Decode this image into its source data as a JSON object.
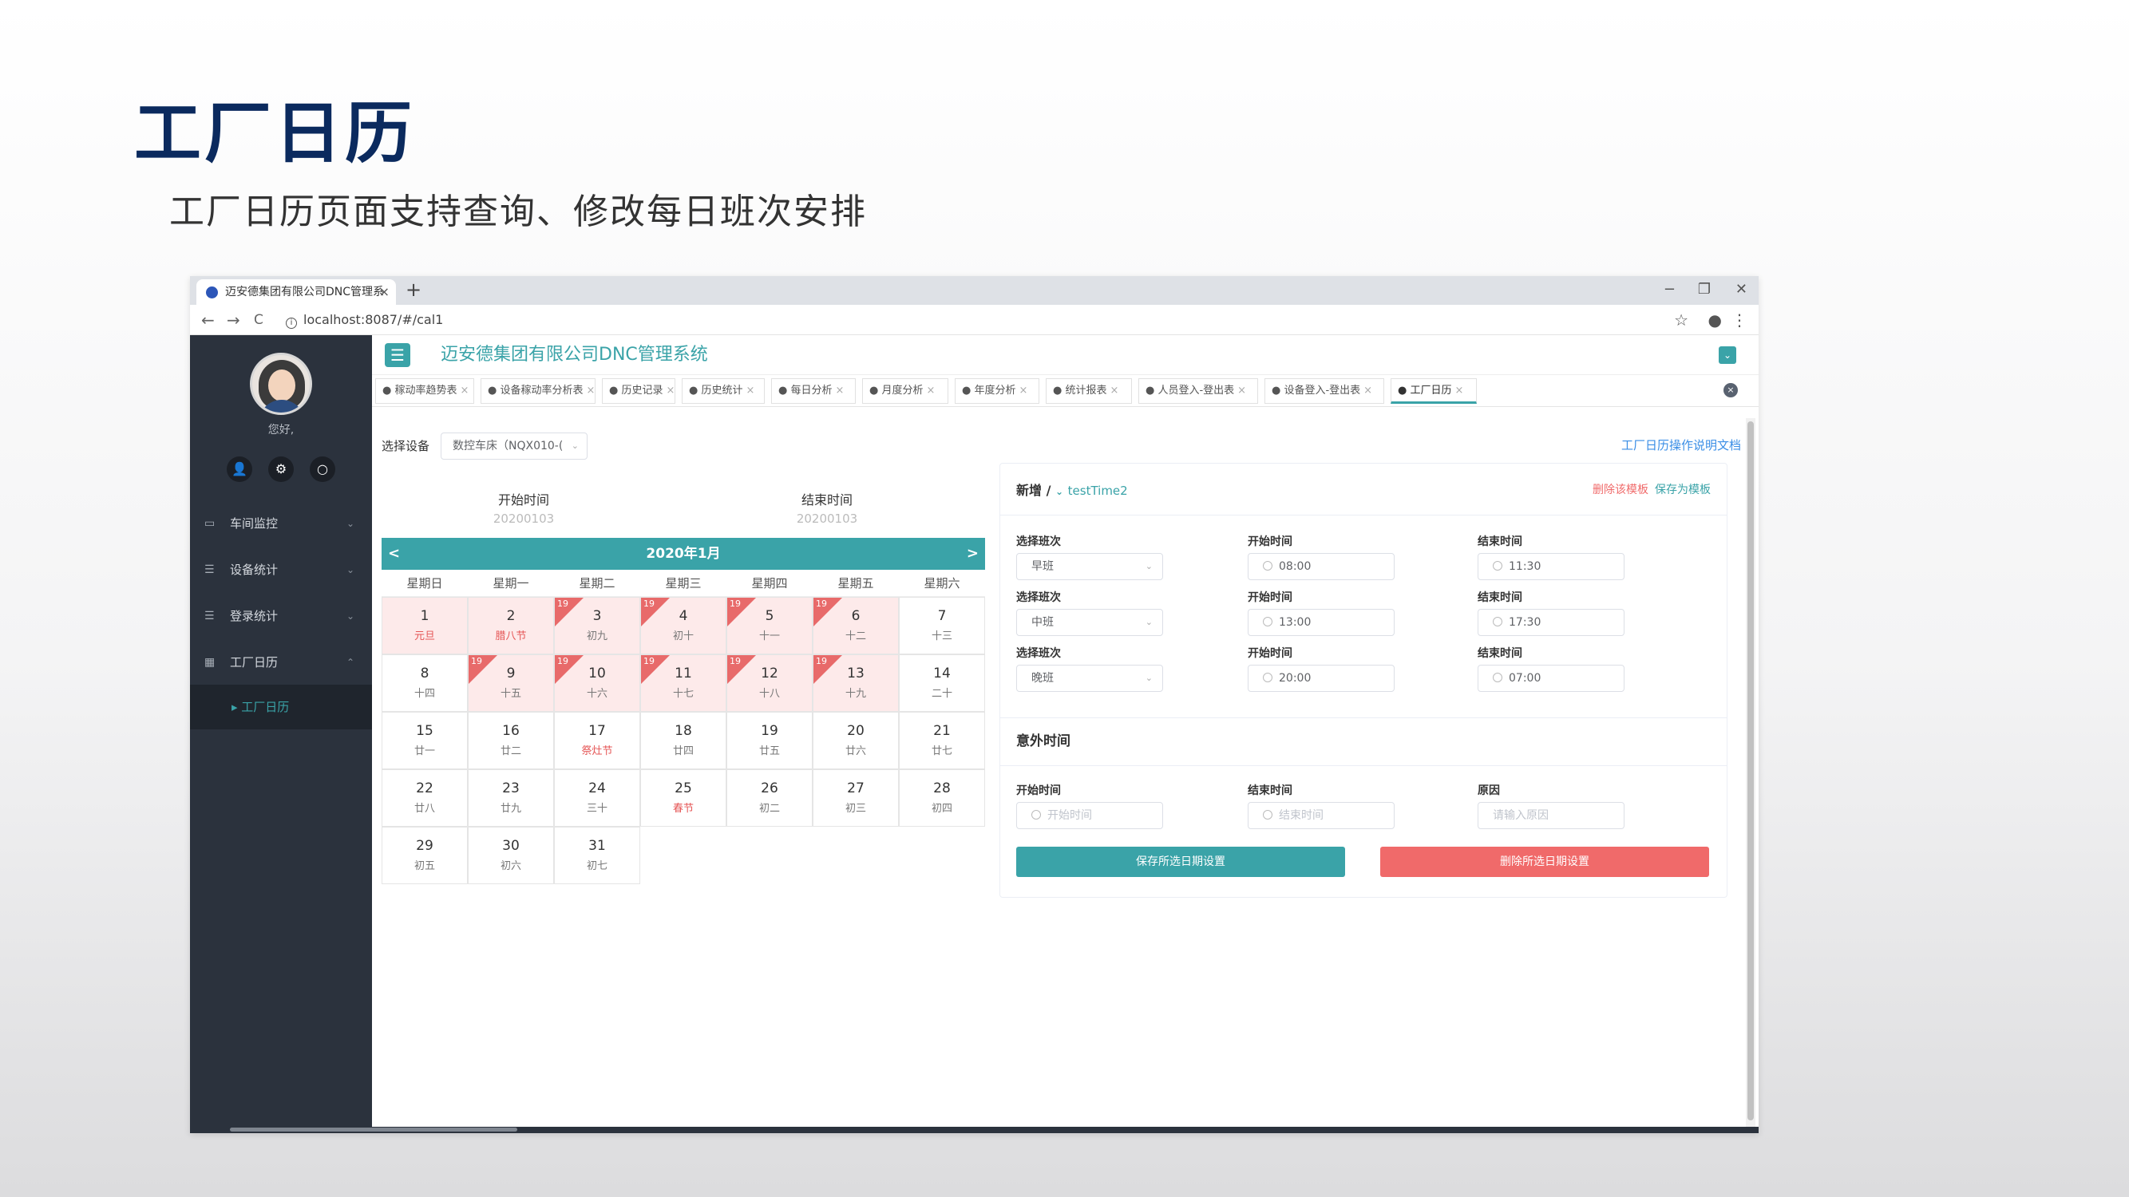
{
  "slide": {
    "title": "工厂日历",
    "subtitle": "工厂日历页面支持查询、修改每日班次安排"
  },
  "browser": {
    "tab_title": "迈安德集团有限公司DNC管理系",
    "tab_close": "×",
    "new_tab": "+",
    "url": "localhost:8087/#/cal1",
    "window_controls": [
      "−",
      "❐",
      "✕"
    ],
    "nav_icons": [
      "back-icon",
      "forward-icon",
      "reload-icon"
    ],
    "nav_glyphs": [
      "←",
      "→",
      "C"
    ]
  },
  "sidebar": {
    "greeting": "您好,",
    "icon_glyphs": [
      "👤",
      "⚙",
      "○"
    ],
    "menus": [
      {
        "label": "车间监控",
        "icon": "monitor-icon",
        "glyph": "▭",
        "chevron": "⌄"
      },
      {
        "label": "设备统计",
        "icon": "list-icon",
        "glyph": "☰",
        "chevron": "⌄"
      },
      {
        "label": "登录统计",
        "icon": "list-icon",
        "glyph": "☰",
        "chevron": "⌄"
      },
      {
        "label": "工厂日历",
        "icon": "calendar-icon",
        "glyph": "▦",
        "chevron": "⌃"
      }
    ],
    "submenu": "▸ 工厂日历"
  },
  "app": {
    "title": "迈安德集团有限公司DNC管理系统",
    "burger": "☰",
    "expand": "⌄",
    "close_all": "×"
  },
  "page_tabs": [
    "● 稼动率趋势表",
    "● 设备稼动率分析表",
    "● 历史记录",
    "● 历史统计",
    "● 每日分析",
    "● 月度分析",
    "● 年度分析",
    "● 统计报表",
    "● 人员登入-登出表",
    "● 设备登入-登出表",
    "● 工厂日历"
  ],
  "tab_close": "×",
  "filter": {
    "label": "选择设备",
    "device": "数控车床（NQX010-(",
    "chevron": "⌄",
    "help_link": "工厂日历操作说明文档"
  },
  "range": {
    "start_label": "开始时间",
    "start_value": "20200103",
    "end_label": "结束时间",
    "end_value": "20200103"
  },
  "calendar": {
    "month": "2020年1月",
    "prev": "<",
    "next": ">",
    "weekdays": [
      "星期日",
      "星期一",
      "星期二",
      "星期三",
      "星期四",
      "星期五",
      "星期六"
    ],
    "days": [
      {
        "d": "1",
        "l": "元旦",
        "red": true,
        "sel": true,
        "flag": ""
      },
      {
        "d": "2",
        "l": "腊八节",
        "red": true,
        "sel": true,
        "flag": ""
      },
      {
        "d": "3",
        "l": "初九",
        "sel": true,
        "flag": "19"
      },
      {
        "d": "4",
        "l": "初十",
        "sel": true,
        "flag": "19"
      },
      {
        "d": "5",
        "l": "十一",
        "sel": true,
        "flag": "19"
      },
      {
        "d": "6",
        "l": "十二",
        "sel": true,
        "flag": "19"
      },
      {
        "d": "7",
        "l": "十三",
        "sel": false,
        "flag": ""
      },
      {
        "d": "8",
        "l": "十四",
        "sel": false,
        "flag": ""
      },
      {
        "d": "9",
        "l": "十五",
        "sel": true,
        "flag": "19"
      },
      {
        "d": "10",
        "l": "十六",
        "sel": true,
        "flag": "19"
      },
      {
        "d": "11",
        "l": "十七",
        "sel": true,
        "flag": "19"
      },
      {
        "d": "12",
        "l": "十八",
        "sel": true,
        "flag": "19"
      },
      {
        "d": "13",
        "l": "十九",
        "sel": true,
        "flag": "19"
      },
      {
        "d": "14",
        "l": "二十",
        "sel": false,
        "flag": ""
      },
      {
        "d": "15",
        "l": "廿一"
      },
      {
        "d": "16",
        "l": "廿二"
      },
      {
        "d": "17",
        "l": "祭灶节",
        "red": true
      },
      {
        "d": "18",
        "l": "廿四"
      },
      {
        "d": "19",
        "l": "廿五"
      },
      {
        "d": "20",
        "l": "廿六"
      },
      {
        "d": "21",
        "l": "廿七"
      },
      {
        "d": "22",
        "l": "廿八"
      },
      {
        "d": "23",
        "l": "廿九"
      },
      {
        "d": "24",
        "l": "三十"
      },
      {
        "d": "25",
        "l": "春节",
        "red": true
      },
      {
        "d": "26",
        "l": "初二"
      },
      {
        "d": "27",
        "l": "初三"
      },
      {
        "d": "28",
        "l": "初四"
      },
      {
        "d": "29",
        "l": "初五"
      },
      {
        "d": "30",
        "l": "初六"
      },
      {
        "d": "31",
        "l": "初七"
      }
    ]
  },
  "panel": {
    "title_prefix": "新增 / ",
    "template_name": "testTime2",
    "title_chevron": "⌄",
    "delete_template": "删除该模板",
    "save_template": "保存为模板",
    "shift_label": "选择班次",
    "start_label": "开始时间",
    "end_label": "结束时间",
    "shifts": [
      {
        "name": "早班",
        "start": "08:00",
        "end": "11:30"
      },
      {
        "name": "中班",
        "start": "13:00",
        "end": "17:30"
      },
      {
        "name": "晚班",
        "start": "20:00",
        "end": "07:00"
      }
    ],
    "unexpected_title": "意外时间",
    "unexpected": {
      "start_label": "开始时间",
      "start_ph": "开始时间",
      "end_label": "结束时间",
      "end_ph": "结束时间",
      "reason_label": "原因",
      "reason_ph": "请输入原因"
    },
    "save_button": "保存所选日期设置",
    "delete_button": "删除所选日期设置"
  },
  "colors": {
    "teal": "#3aa3a8",
    "red": "#f06a6a",
    "sidebar": "#2b323d",
    "title": "#0b2a5e"
  }
}
